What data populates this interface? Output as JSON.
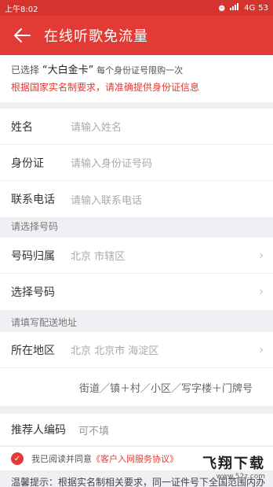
{
  "status_bar": {
    "time": "上午8:02",
    "network": "4G",
    "battery": "53"
  },
  "header": {
    "title": "在线听歌免流量"
  },
  "notice": {
    "prefix": "已选择",
    "card": "“大白金卡”",
    "suffix": "每个身份证号限购一次",
    "warning": "根据国家实名制要求，请准确提供身份证信息"
  },
  "identity": {
    "name_label": "姓名",
    "name_placeholder": "请输入姓名",
    "id_label": "身份证",
    "id_placeholder": "请输入身份证号码",
    "phone_label": "联系电话",
    "phone_placeholder": "请输入联系电话"
  },
  "number_section": {
    "title": "请选择号码",
    "location_label": "号码归属",
    "location_value": "北京 市辖区",
    "select_label": "选择号码"
  },
  "address_section": {
    "title": "请填写配送地址",
    "region_label": "所在地区",
    "region_value": "北京 北京市 海淀区",
    "detail_placeholder": "街道／镇＋村／小区／写字楼＋门牌号"
  },
  "referrer": {
    "label": "推荐人编码",
    "placeholder": "可不填"
  },
  "agreement": {
    "text": "我已阅读并同意",
    "link": "《客户入网服务协议》"
  },
  "tip": "温馨提示：根据实名制相关要求，同一证件号下全国范围内办",
  "watermark": {
    "big": "飞翔下载",
    "small": "www.52z.com"
  },
  "colors": {
    "primary": "#e23b35",
    "status_bar": "#d4332e"
  }
}
